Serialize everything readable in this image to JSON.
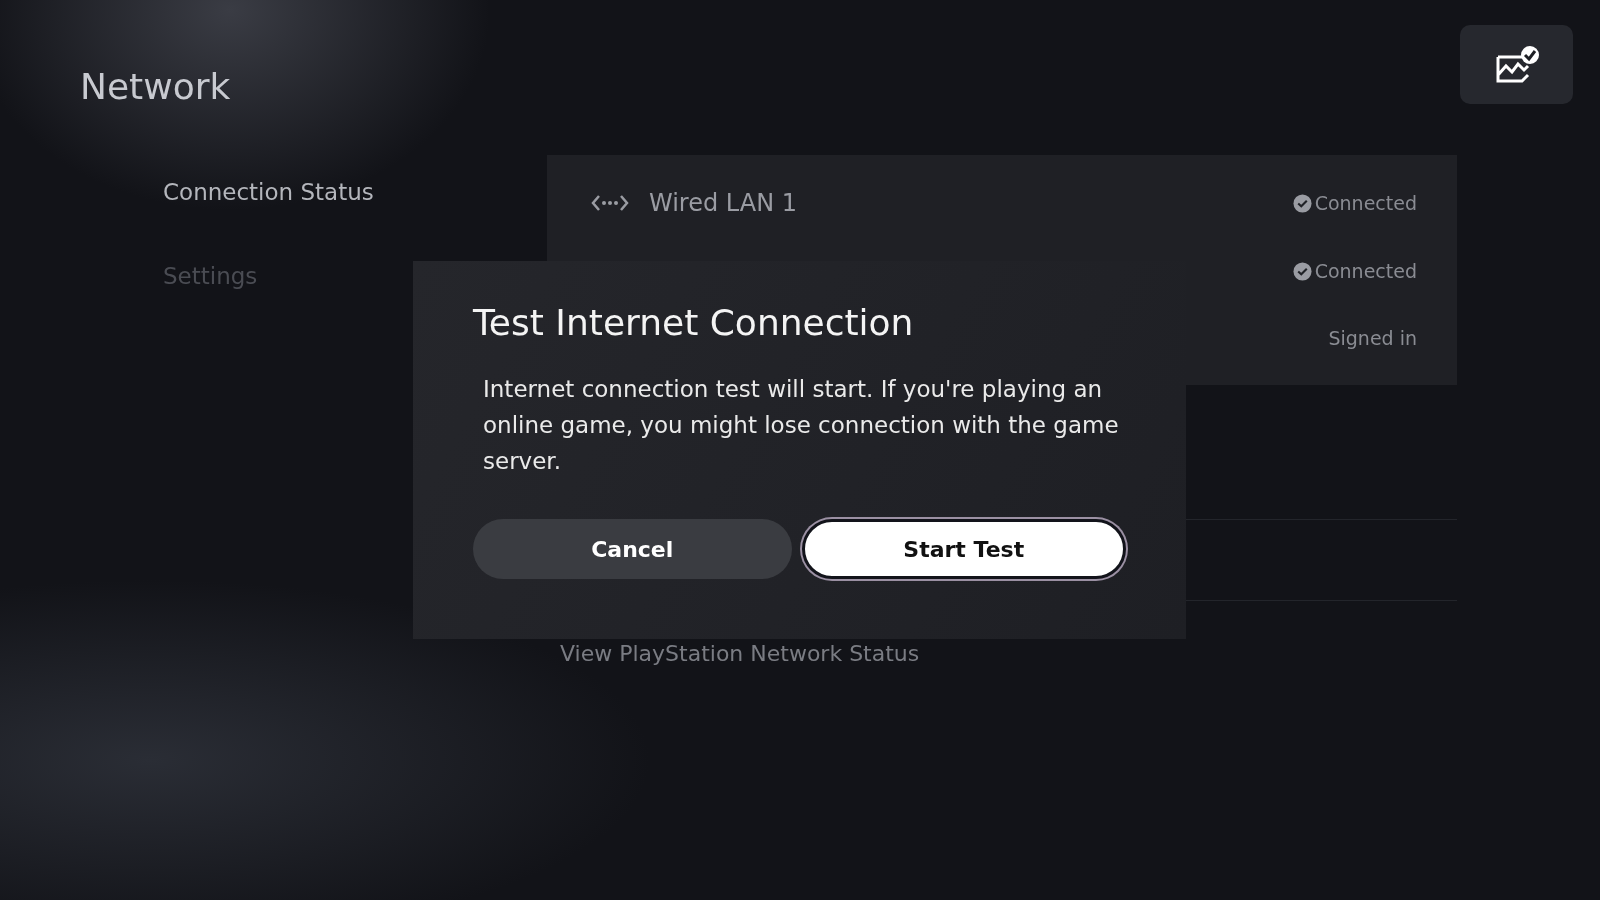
{
  "page": {
    "title": "Network"
  },
  "sidebar": {
    "items": [
      {
        "label": "Connection Status",
        "selected": true
      },
      {
        "label": "Settings",
        "selected": false
      }
    ]
  },
  "status_rows": [
    {
      "label": "Wired LAN 1",
      "status": "Connected",
      "verified": true
    },
    {
      "status": "Connected",
      "verified": true
    },
    {
      "status": "Signed in",
      "verified": false
    }
  ],
  "link_below": "View PlayStation Network Status",
  "dialog": {
    "title": "Test Internet Connection",
    "message": "Internet connection test will start. If you're playing an online game, you might lose connection with the game server.",
    "buttons": [
      {
        "label": "Cancel",
        "focused": false
      },
      {
        "label": "Start Test",
        "focused": true
      }
    ]
  }
}
